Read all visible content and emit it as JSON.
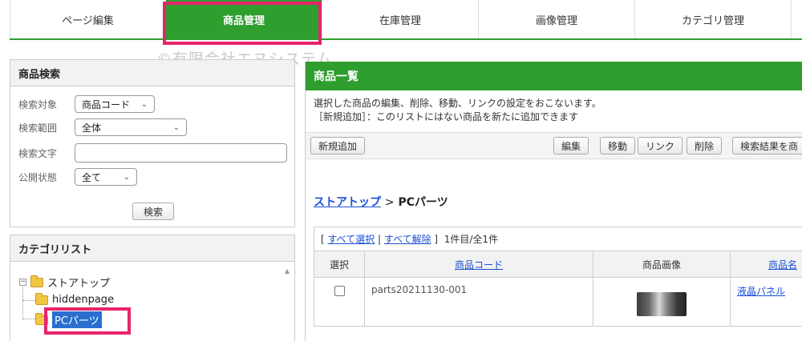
{
  "top_tabs": [
    {
      "label": "ページ編集",
      "active": false
    },
    {
      "label": "商品管理",
      "active": true
    },
    {
      "label": "在庫管理",
      "active": false
    },
    {
      "label": "画像管理",
      "active": false
    },
    {
      "label": "カテゴリ管理",
      "active": false
    }
  ],
  "watermark": "©有限会社エヌシステム",
  "search_panel": {
    "title": "商品検索",
    "target_label": "検索対象",
    "target_value": "商品コード",
    "range_label": "検索範囲",
    "range_value": "全体",
    "text_label": "検索文字",
    "text_value": "",
    "status_label": "公開状態",
    "status_value": "全て",
    "search_button": "検索"
  },
  "category_panel": {
    "title": "カテゴリリスト",
    "root": "ストアトップ",
    "children": [
      "hiddenpage",
      "PCパーツ"
    ],
    "selected": "PCパーツ"
  },
  "main": {
    "title": "商品一覧",
    "desc_line1": "選択した商品の編集、削除、移動、リンクの設定をおこないます。",
    "desc_line2": "［新規追加］：このリストにはない商品を新たに追加できます",
    "toolbar": {
      "add": "新規追加",
      "edit": "編集",
      "move": "移動",
      "link": "リンク",
      "delete": "削除",
      "search_result": "検索結果を商"
    },
    "breadcrumb_link": "ストアトップ",
    "breadcrumb_sep": ">",
    "breadcrumb_current": "PCパーツ",
    "list_bar": {
      "open": "[",
      "select_all": "すべて選択",
      "sep": "|",
      "deselect_all": "すべて解除",
      "close": "]",
      "count": "1件目/全1件"
    },
    "table": {
      "headers": [
        "選択",
        "商品コード",
        "商品画像",
        "商品名"
      ],
      "rows": [
        {
          "code": "parts20211130-001",
          "name": "液晶パネル"
        }
      ]
    }
  },
  "colors": {
    "accent_green": "#2e9e2e",
    "highlight_pink": "#e8246c",
    "link_blue": "#1a4fd6"
  }
}
